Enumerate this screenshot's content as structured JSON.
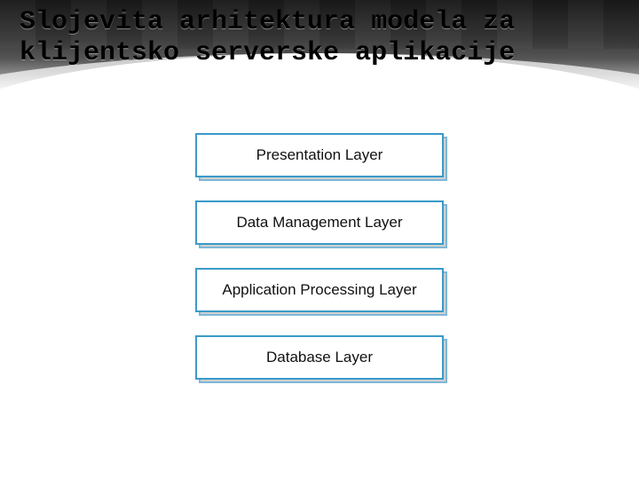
{
  "title": "Slojevita arhitektura modela za klijentsko serverske aplikacije",
  "layers": [
    {
      "label": "Presentation Layer"
    },
    {
      "label": "Data Management Layer"
    },
    {
      "label": "Application Processing Layer"
    },
    {
      "label": "Database Layer"
    }
  ],
  "colors": {
    "border": "#3a9bc9",
    "shadow": "#d0d0d0"
  }
}
